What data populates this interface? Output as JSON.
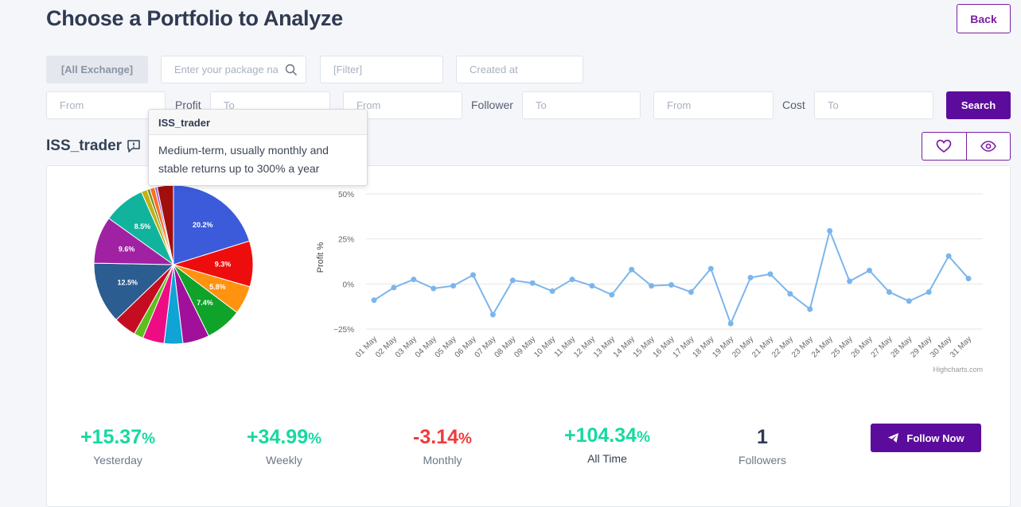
{
  "page": {
    "title": "Choose a Portfolio to Analyze",
    "back_label": "Back"
  },
  "filters": {
    "exchange_label": "[All Exchange]",
    "package_placeholder": "Enter your package na",
    "filter_placeholder": "[Filter]",
    "created_placeholder": "Created at",
    "profit_label": "Profit",
    "follower_label": "Follower",
    "cost_label": "Cost",
    "from_placeholder": "From",
    "to_placeholder": "To",
    "search_label": "Search"
  },
  "portfolio": {
    "name": "ISS_trader",
    "tooltip_title": "ISS_trader",
    "tooltip_text": "Medium-term, usually monthly and stable returns up to 300% a year"
  },
  "chart_data": [
    {
      "type": "pie",
      "slices": [
        {
          "value": 20.2,
          "label": "20.2%",
          "color": "#3b5bdb"
        },
        {
          "value": 9.3,
          "label": "9.3%",
          "color": "#ee0d0d"
        },
        {
          "value": 5.8,
          "label": "5.8%",
          "color": "#ff930f"
        },
        {
          "value": 7.4,
          "label": "7.4%",
          "color": "#10a32a"
        },
        {
          "value": 5.4,
          "label": "",
          "color": "#a0109a"
        },
        {
          "value": 3.8,
          "label": "",
          "color": "#0fa3d6"
        },
        {
          "value": 4.4,
          "label": "",
          "color": "#ee0c84"
        },
        {
          "value": 1.9,
          "label": "",
          "color": "#5cbf1e"
        },
        {
          "value": 4.6,
          "label": "",
          "color": "#c50d22"
        },
        {
          "value": 12.5,
          "label": "12.5%",
          "color": "#2c5d91"
        },
        {
          "value": 9.6,
          "label": "9.6%",
          "color": "#a121a3"
        },
        {
          "value": 8.5,
          "label": "8.5%",
          "color": "#12b39d"
        },
        {
          "value": 1.2,
          "label": "",
          "color": "#c4b012"
        },
        {
          "value": 0.6,
          "label": "",
          "color": "#6b8e23"
        },
        {
          "value": 1.0,
          "label": "",
          "color": "#ff6f1e"
        },
        {
          "value": 0.5,
          "label": "",
          "color": "#9a63d8"
        },
        {
          "value": 3.3,
          "label": "",
          "color": "#a10e0e"
        }
      ]
    },
    {
      "type": "line",
      "ylabel": "Profit %",
      "ylim": [
        -25,
        50
      ],
      "yticks": [
        "50%",
        "25%",
        "0%",
        "−25%"
      ],
      "ytick_values": [
        50,
        25,
        0,
        -25
      ],
      "x": [
        "01 May",
        "02 May",
        "03 May",
        "04 May",
        "05 May",
        "06 May",
        "07 May",
        "08 May",
        "09 May",
        "10 May",
        "11 May",
        "12 May",
        "13 May",
        "14 May",
        "15 May",
        "16 May",
        "17 May",
        "18 May",
        "19 May",
        "20 May",
        "21 May",
        "22 May",
        "23 May",
        "24 May",
        "25 May",
        "26 May",
        "27 May",
        "28 May",
        "29 May",
        "30 May",
        "31 May"
      ],
      "series": [
        {
          "values": [
            -9,
            -2,
            2.5,
            -2.5,
            -1,
            5,
            -17,
            2,
            0.5,
            -4,
            2.5,
            -1,
            -6,
            8,
            -1,
            -0.5,
            -4.5,
            8.5,
            -22,
            3.5,
            5.5,
            -5.5,
            -14,
            29.5,
            1.5,
            7.5,
            -4.5,
            -9.5,
            -4.5,
            15.5,
            3
          ]
        }
      ],
      "line_color": "#7cb5ec",
      "credits": "Highcharts.com"
    }
  ],
  "stats": {
    "yesterday": {
      "value": "+15.37",
      "unit": "%",
      "label": "Yesterday"
    },
    "weekly": {
      "value": "+34.99",
      "unit": "%",
      "label": "Weekly"
    },
    "monthly": {
      "value": "-3.14",
      "unit": "%",
      "label": "Monthly"
    },
    "all_time": {
      "value": "+104.34",
      "unit": "%",
      "label": "All Time"
    },
    "followers": {
      "value": "1",
      "label": "Followers"
    }
  },
  "follow": {
    "label": "Follow Now"
  },
  "icons": {
    "search": "search-icon",
    "comment": "comment-icon",
    "heart": "heart-icon",
    "eye": "eye-icon",
    "send": "send-icon"
  },
  "colors": {
    "accent": "#5c0c9c",
    "positive": "#16d9a1",
    "negative": "#ef3b3b"
  }
}
